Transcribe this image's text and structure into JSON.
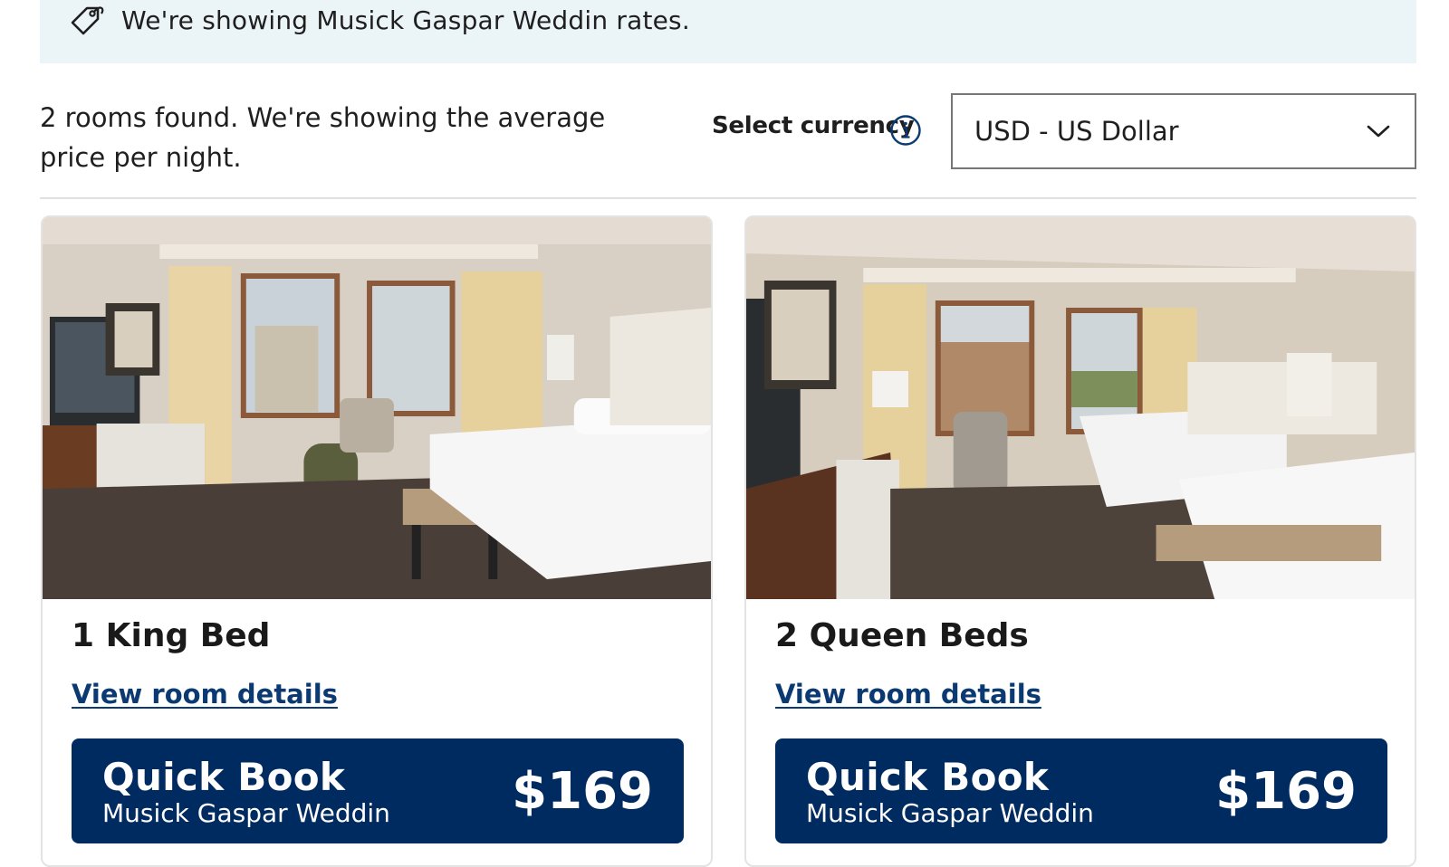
{
  "banner": {
    "icon": "price-tag-icon",
    "text": "We're showing Musick Gaspar Weddin rates."
  },
  "results": {
    "summary": "2 rooms found. We're showing the average price per night."
  },
  "currency": {
    "label": "Select currency",
    "info_icon": "info-icon",
    "selected": "USD - US Dollar"
  },
  "rooms": [
    {
      "name": "1 King Bed",
      "details_link": "View room details",
      "quick_book": {
        "title": "Quick Book",
        "rate_name": "Musick Gaspar Weddin",
        "price": "$169"
      }
    },
    {
      "name": "2 Queen Beds",
      "details_link": "View room details",
      "quick_book": {
        "title": "Quick Book",
        "rate_name": "Musick Gaspar Weddin",
        "price": "$169"
      }
    }
  ],
  "colors": {
    "banner_bg": "#ebf4f7",
    "button_bg": "#002b61",
    "link": "#0b3a72"
  }
}
